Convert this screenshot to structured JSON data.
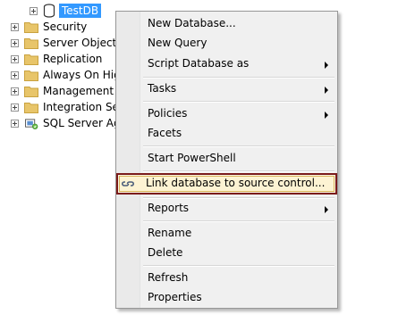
{
  "tree": {
    "database_node": "TestDB",
    "nodes": [
      "Security",
      "Server Objects",
      "Replication",
      "Always On Hig",
      "Management",
      "Integration Serv",
      "SQL Server Age"
    ]
  },
  "menu": {
    "new_database": "New Database...",
    "new_query": "New Query",
    "script_database_as": "Script Database as",
    "tasks": "Tasks",
    "policies": "Policies",
    "facets": "Facets",
    "start_powershell": "Start PowerShell",
    "link_database": "Link database to source control...",
    "reports": "Reports",
    "rename": "Rename",
    "delete": "Delete",
    "refresh": "Refresh",
    "properties": "Properties"
  }
}
